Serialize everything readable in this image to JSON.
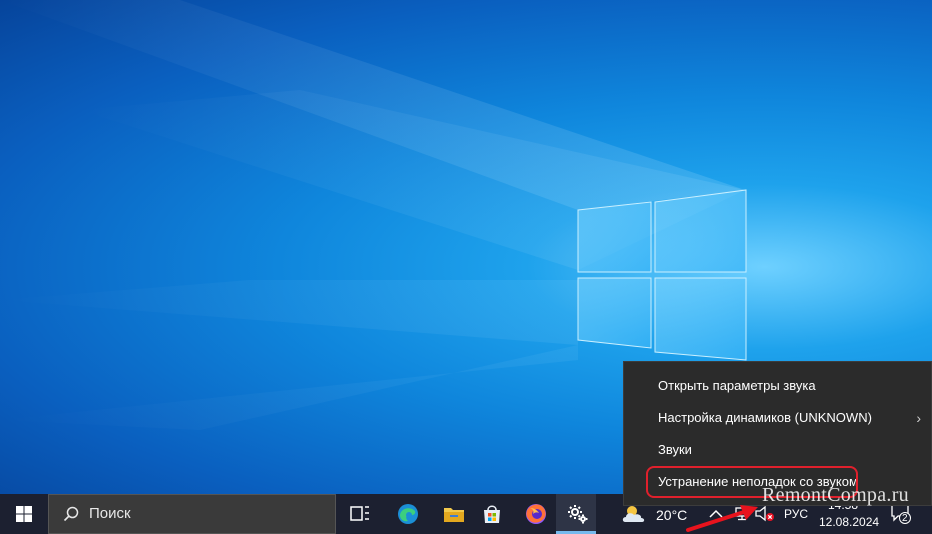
{
  "context_menu": {
    "items": [
      {
        "label": "Открыть параметры звука"
      },
      {
        "label": "Настройка динамиков (UNKNOWN)",
        "submenu": "›"
      },
      {
        "label": "Звуки"
      },
      {
        "label": "Устранение неполадок со звуком"
      }
    ]
  },
  "taskbar": {
    "search_placeholder": "Поиск",
    "weather_temp": "20°C",
    "language": "РУС",
    "time": "14:58",
    "date": "12.08.2024",
    "notification_count": "2"
  },
  "watermark": "RemontCompa.ru",
  "colors": {
    "taskbar_bg": "#1c2030",
    "menu_bg": "#2b2b2b",
    "highlight_ring": "#e0202c",
    "desktop_blue": "#0f86dc"
  },
  "icons": [
    "windows-start-icon",
    "search-icon",
    "task-view-icon",
    "edge-icon",
    "file-explorer-icon",
    "store-icon",
    "firefox-icon",
    "settings-icon",
    "weather-icon",
    "chevron-up-icon",
    "network-icon",
    "speaker-muted-icon",
    "notification-icon"
  ]
}
